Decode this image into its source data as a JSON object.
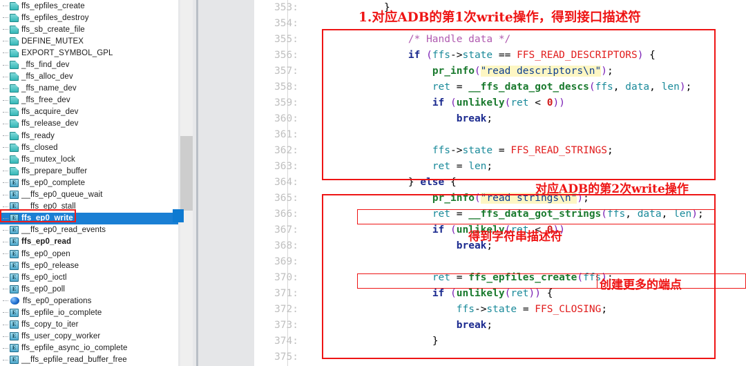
{
  "outline": {
    "items": [
      {
        "label": "ffs_epfiles_create",
        "icon": "page-icon",
        "bold": false,
        "selected": false
      },
      {
        "label": "ffs_epfiles_destroy",
        "icon": "page-icon",
        "bold": false,
        "selected": false
      },
      {
        "label": "ffs_sb_create_file",
        "icon": "page-icon",
        "bold": false,
        "selected": false
      },
      {
        "label": "DEFINE_MUTEX",
        "icon": "page-icon",
        "bold": false,
        "selected": false
      },
      {
        "label": "EXPORT_SYMBOL_GPL",
        "icon": "page-icon",
        "bold": false,
        "selected": false
      },
      {
        "label": "_ffs_find_dev",
        "icon": "page-icon",
        "bold": false,
        "selected": false
      },
      {
        "label": "_ffs_alloc_dev",
        "icon": "page-icon",
        "bold": false,
        "selected": false
      },
      {
        "label": "_ffs_name_dev",
        "icon": "page-icon",
        "bold": false,
        "selected": false
      },
      {
        "label": "_ffs_free_dev",
        "icon": "page-icon",
        "bold": false,
        "selected": false
      },
      {
        "label": "ffs_acquire_dev",
        "icon": "page-icon",
        "bold": false,
        "selected": false
      },
      {
        "label": "ffs_release_dev",
        "icon": "page-icon",
        "bold": false,
        "selected": false
      },
      {
        "label": "ffs_ready",
        "icon": "page-icon",
        "bold": false,
        "selected": false
      },
      {
        "label": "ffs_closed",
        "icon": "page-icon",
        "bold": false,
        "selected": false
      },
      {
        "label": "ffs_mutex_lock",
        "icon": "page-icon",
        "bold": false,
        "selected": false
      },
      {
        "label": "ffs_prepare_buffer",
        "icon": "page-icon",
        "bold": false,
        "selected": false
      },
      {
        "label": "ffs_ep0_complete",
        "icon": "function-icon",
        "bold": false,
        "selected": false
      },
      {
        "label": "__ffs_ep0_queue_wait",
        "icon": "function-icon",
        "bold": false,
        "selected": false
      },
      {
        "label": "__ffs_ep0_stall",
        "icon": "function-icon",
        "bold": false,
        "selected": false
      },
      {
        "label": "ffs_ep0_write",
        "icon": "function-icon",
        "bold": true,
        "selected": true
      },
      {
        "label": "__ffs_ep0_read_events",
        "icon": "function-icon",
        "bold": false,
        "selected": false
      },
      {
        "label": "ffs_ep0_read",
        "icon": "function-icon",
        "bold": true,
        "selected": false
      },
      {
        "label": "ffs_ep0_open",
        "icon": "function-icon",
        "bold": false,
        "selected": false
      },
      {
        "label": "ffs_ep0_release",
        "icon": "function-icon",
        "bold": false,
        "selected": false
      },
      {
        "label": "ffs_ep0_ioctl",
        "icon": "function-icon",
        "bold": false,
        "selected": false
      },
      {
        "label": "ffs_ep0_poll",
        "icon": "function-icon",
        "bold": false,
        "selected": false
      },
      {
        "label": "ffs_ep0_operations",
        "icon": "sphere-icon",
        "bold": false,
        "selected": false
      },
      {
        "label": "ffs_epfile_io_complete",
        "icon": "function-icon",
        "bold": false,
        "selected": false
      },
      {
        "label": "ffs_copy_to_iter",
        "icon": "function-icon",
        "bold": false,
        "selected": false
      },
      {
        "label": "ffs_user_copy_worker",
        "icon": "function-icon",
        "bold": false,
        "selected": false
      },
      {
        "label": "ffs_epfile_async_io_complete",
        "icon": "function-icon",
        "bold": false,
        "selected": false
      },
      {
        "label": "__ffs_epfile_read_buffer_free",
        "icon": "function-icon",
        "bold": false,
        "selected": false
      }
    ]
  },
  "editor": {
    "line_numbers": [
      "353:",
      "354:",
      "355:",
      "356:",
      "357:",
      "358:",
      "359:",
      "360:",
      "361:",
      "362:",
      "363:",
      "364:",
      "365:",
      "366:",
      "367:",
      "368:",
      "369:",
      "370:",
      "371:",
      "372:",
      "373:",
      "374:",
      "375:"
    ],
    "lines": [
      {
        "n": "353:",
        "text": "    }"
      },
      {
        "n": "354:",
        "text": ""
      },
      {
        "n": "355:",
        "text": "        /* Handle data */"
      },
      {
        "n": "356:",
        "text": "        if (ffs->state == FFS_READ_DESCRIPTORS) {"
      },
      {
        "n": "357:",
        "text": "            pr_info(\"read descriptors\\n\");"
      },
      {
        "n": "358:",
        "text": "            ret = __ffs_data_got_descs(ffs, data, len);"
      },
      {
        "n": "359:",
        "text": "            if (unlikely(ret < 0))"
      },
      {
        "n": "360:",
        "text": "                break;"
      },
      {
        "n": "361:",
        "text": ""
      },
      {
        "n": "362:",
        "text": "            ffs->state = FFS_READ_STRINGS;"
      },
      {
        "n": "363:",
        "text": "            ret = len;"
      },
      {
        "n": "364:",
        "text": "        } else {"
      },
      {
        "n": "365:",
        "text": "            pr_info(\"read strings\\n\");"
      },
      {
        "n": "366:",
        "text": "            ret = __ffs_data_got_strings(ffs, data, len);"
      },
      {
        "n": "367:",
        "text": "            if (unlikely(ret < 0))"
      },
      {
        "n": "368:",
        "text": "                break;"
      },
      {
        "n": "369:",
        "text": ""
      },
      {
        "n": "370:",
        "text": "            ret = ffs_epfiles_create(ffs);"
      },
      {
        "n": "371:",
        "text": "            if (unlikely(ret)) {"
      },
      {
        "n": "372:",
        "text": "                ffs->state = FFS_CLOSING;"
      },
      {
        "n": "373:",
        "text": "                break;"
      },
      {
        "n": "374:",
        "text": "            }"
      },
      {
        "n": "375:",
        "text": ""
      }
    ]
  },
  "annotations": {
    "note_1": "1.对应ADB的第1次write操作，得到接口描述符",
    "note_2": "对应ADB的第2次write操作",
    "note_3": "得到字符串描述符",
    "note_4": "创建更多的端点"
  },
  "colors": {
    "annotation_red": "#ee1414",
    "selection_blue": "#1a7fd4",
    "highlight_yellow": "#fdf6c3",
    "line_number_gray": "#bfbfbf"
  }
}
